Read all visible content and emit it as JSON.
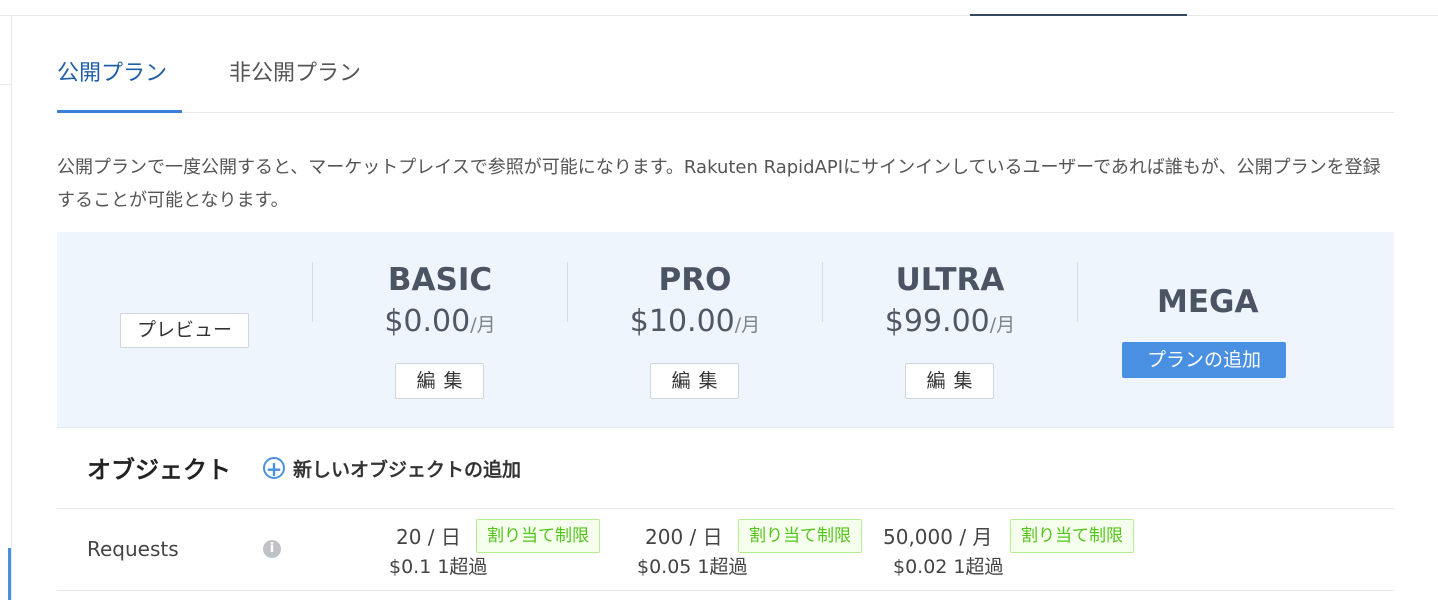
{
  "tabs": [
    {
      "label": "公開プラン",
      "active": true
    },
    {
      "label": "非公開プラン",
      "active": false
    }
  ],
  "description": "公開プランで一度公開すると、マーケットプレイスで参照が可能になります。Rakuten RapidAPIにサインインしているユーザーであれば誰もが、公開プランを登録することが可能となります。",
  "plans_header": {
    "preview_label": "プレビュー",
    "plans": [
      {
        "name": "BASIC",
        "price": "$0.00",
        "per": "/月",
        "edit_label": "編集"
      },
      {
        "name": "PRO",
        "price": "$10.00",
        "per": "/月",
        "edit_label": "編集"
      },
      {
        "name": "ULTRA",
        "price": "$99.00",
        "per": "/月",
        "edit_label": "編集"
      }
    ],
    "mega": {
      "name": "MEGA",
      "add_label": "プランの追加"
    }
  },
  "objects": {
    "title": "オブジェクト",
    "add_label": "新しいオブジェクトの追加"
  },
  "requests": {
    "label": "Requests",
    "quotas": [
      {
        "amount": "20 / 日",
        "badge": "割り当て制限",
        "overage": "$0.1 1超過"
      },
      {
        "amount": "200 / 日",
        "badge": "割り当て制限",
        "overage": "$0.05 1超過"
      },
      {
        "amount": "50,000 / 月",
        "badge": "割り当て制限",
        "overage": "$0.02 1超過"
      }
    ]
  },
  "colors": {
    "accent": "#4a90e2",
    "plans_bg": "#eef5fd",
    "badge_green": "#52c41a"
  }
}
